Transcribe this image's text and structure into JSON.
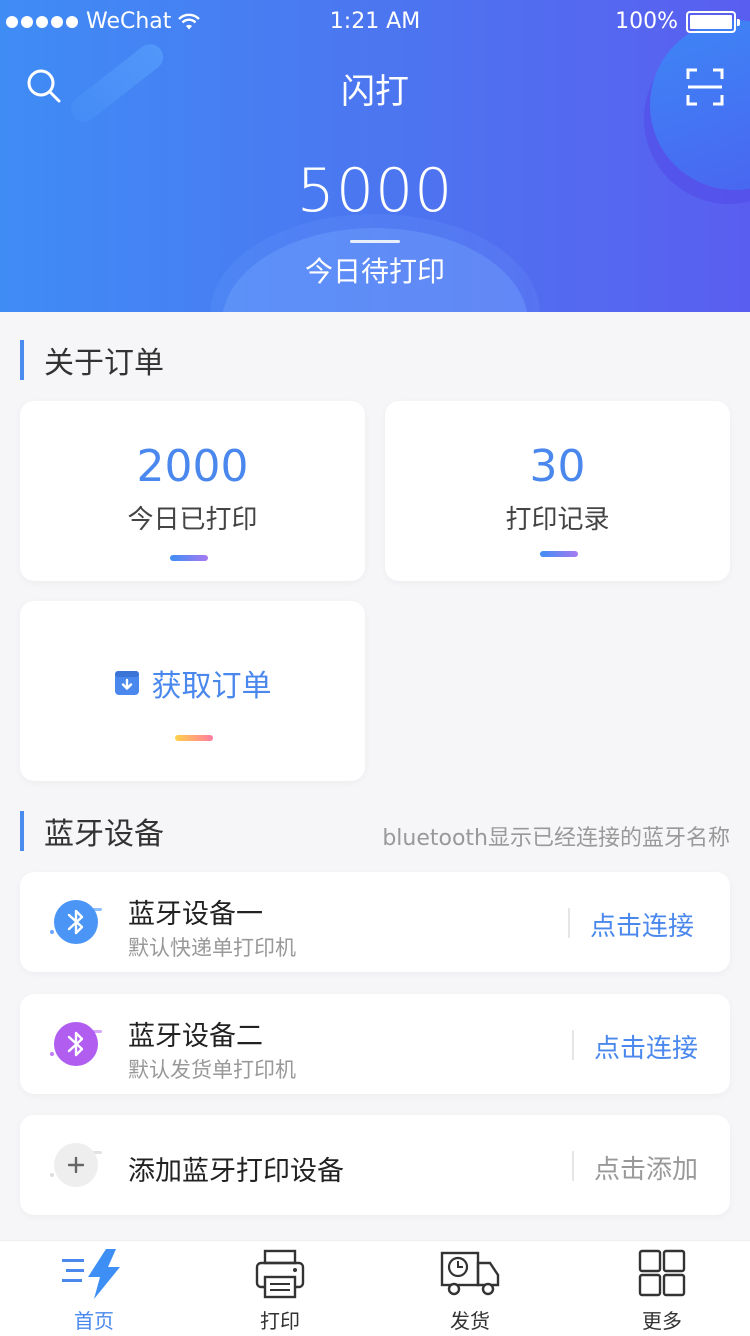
{
  "status": {
    "carrier": "WeChat",
    "time": "1:21 AM",
    "battery": "100%"
  },
  "nav": {
    "title": "闪打"
  },
  "hero": {
    "count": "5000",
    "label": "今日待打印"
  },
  "orders": {
    "section_title": "关于订单",
    "printed_today_value": "2000",
    "printed_today_label": "今日已打印",
    "records_value": "30",
    "records_label": "打印记录",
    "get_order_label": "获取订单"
  },
  "bluetooth": {
    "section_title": "蓝牙设备",
    "note": "bluetooth显示已经连接的蓝牙名称",
    "devices": [
      {
        "name": "蓝牙设备一",
        "desc": "默认快递单打印机",
        "action": "点击连接"
      },
      {
        "name": "蓝牙设备二",
        "desc": "默认发货单打印机",
        "action": "点击连接"
      }
    ],
    "add": {
      "name": "添加蓝牙打印设备",
      "action": "点击添加"
    }
  },
  "tabs": [
    {
      "label": "首页",
      "active": true
    },
    {
      "label": "打印",
      "active": false
    },
    {
      "label": "发货",
      "active": false
    },
    {
      "label": "更多",
      "active": false
    }
  ],
  "colors": {
    "accent": "#4a88ee",
    "header_start": "#3f8cf5",
    "header_end": "#5a5ef0"
  }
}
